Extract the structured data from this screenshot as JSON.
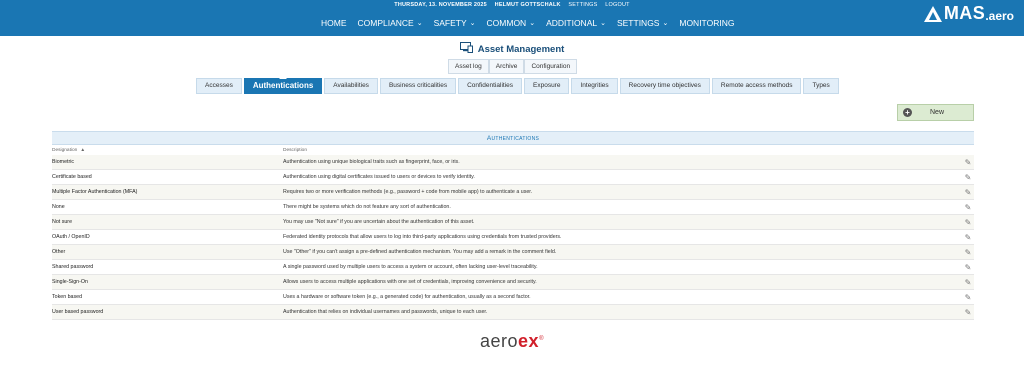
{
  "header": {
    "date": "THURSDAY, 13. NOVEMBER 2025",
    "user": "HELMUT GOTTSCHALK",
    "settings_link": "SETTINGS",
    "logout_link": "LOGOUT",
    "nav": [
      {
        "label": "HOME",
        "has_menu": false
      },
      {
        "label": "COMPLIANCE",
        "has_menu": true
      },
      {
        "label": "SAFETY",
        "has_menu": true
      },
      {
        "label": "COMMON",
        "has_menu": true
      },
      {
        "label": "ADDITIONAL",
        "has_menu": true
      },
      {
        "label": "SETTINGS",
        "has_menu": true
      },
      {
        "label": "MONITORING",
        "has_menu": false
      }
    ],
    "logo_text": "MAS",
    "logo_suffix": ".aero",
    "bg_color": "#1a76b3"
  },
  "page": {
    "title": "Asset Management",
    "title_icon": "asset-monitor-icon"
  },
  "subtabs": [
    "Asset log",
    "Archive",
    "Configuration"
  ],
  "category_tabs": [
    {
      "label": "Accesses",
      "active": false
    },
    {
      "label": "Authentications",
      "active": true
    },
    {
      "label": "Availabilities",
      "active": false
    },
    {
      "label": "Business criticalities",
      "active": false
    },
    {
      "label": "Confidentialities",
      "active": false
    },
    {
      "label": "Exposure",
      "active": false
    },
    {
      "label": "Integrities",
      "active": false
    },
    {
      "label": "Recovery time objectives",
      "active": false
    },
    {
      "label": "Remote access methods",
      "active": false
    },
    {
      "label": "Types",
      "active": false
    }
  ],
  "new_button": {
    "label": "New",
    "icon": "plus-circle-icon"
  },
  "table": {
    "title": "Authentications",
    "columns": {
      "designation": "Designation",
      "description": "Description"
    },
    "sort_indicator": "▲",
    "rows": [
      {
        "designation": "Biometric",
        "description": "Authentication using unique biological traits such as fingerprint, face, or iris."
      },
      {
        "designation": "Certificate based",
        "description": "Authentication using digital certificates issued to users or devices to verify identity."
      },
      {
        "designation": "Multiple Factor Authentication (MFA)",
        "description": "Requires two or more verification methods (e.g., password + code from mobile app) to authenticate a user."
      },
      {
        "designation": "None",
        "description": "There might be systems which do not feature any sort of authentication."
      },
      {
        "designation": "Not sure",
        "description": "You may use \"Not sure\" if you are uncertain about the authentication of this asset."
      },
      {
        "designation": "OAuth / OpenID",
        "description": "Federated identity protocols that allow users to log into third-party applications using credentials from trusted providers."
      },
      {
        "designation": "Other",
        "description": "Use \"Other\" if you can't assign a pre-defined authentication mechanism. You may add a remark in the comment field."
      },
      {
        "designation": "Shared password",
        "description": "A single password used by multiple users to access a system or account, often lacking user-level traceability."
      },
      {
        "designation": "Single-Sign-On",
        "description": "Allows users to access multiple applications with one set of credentials, improving convenience and security."
      },
      {
        "designation": "Token based",
        "description": "Uses a hardware or software token (e.g., a generated code) for authentication, usually as a second factor."
      },
      {
        "designation": "User based password",
        "description": "Authentication that relies on individual usernames and passwords, unique to each user."
      }
    ],
    "edit_icon": "pencil-icon"
  },
  "footer": {
    "logo_text_a": "aero",
    "logo_text_b": "ex",
    "logo_mark": "®"
  }
}
